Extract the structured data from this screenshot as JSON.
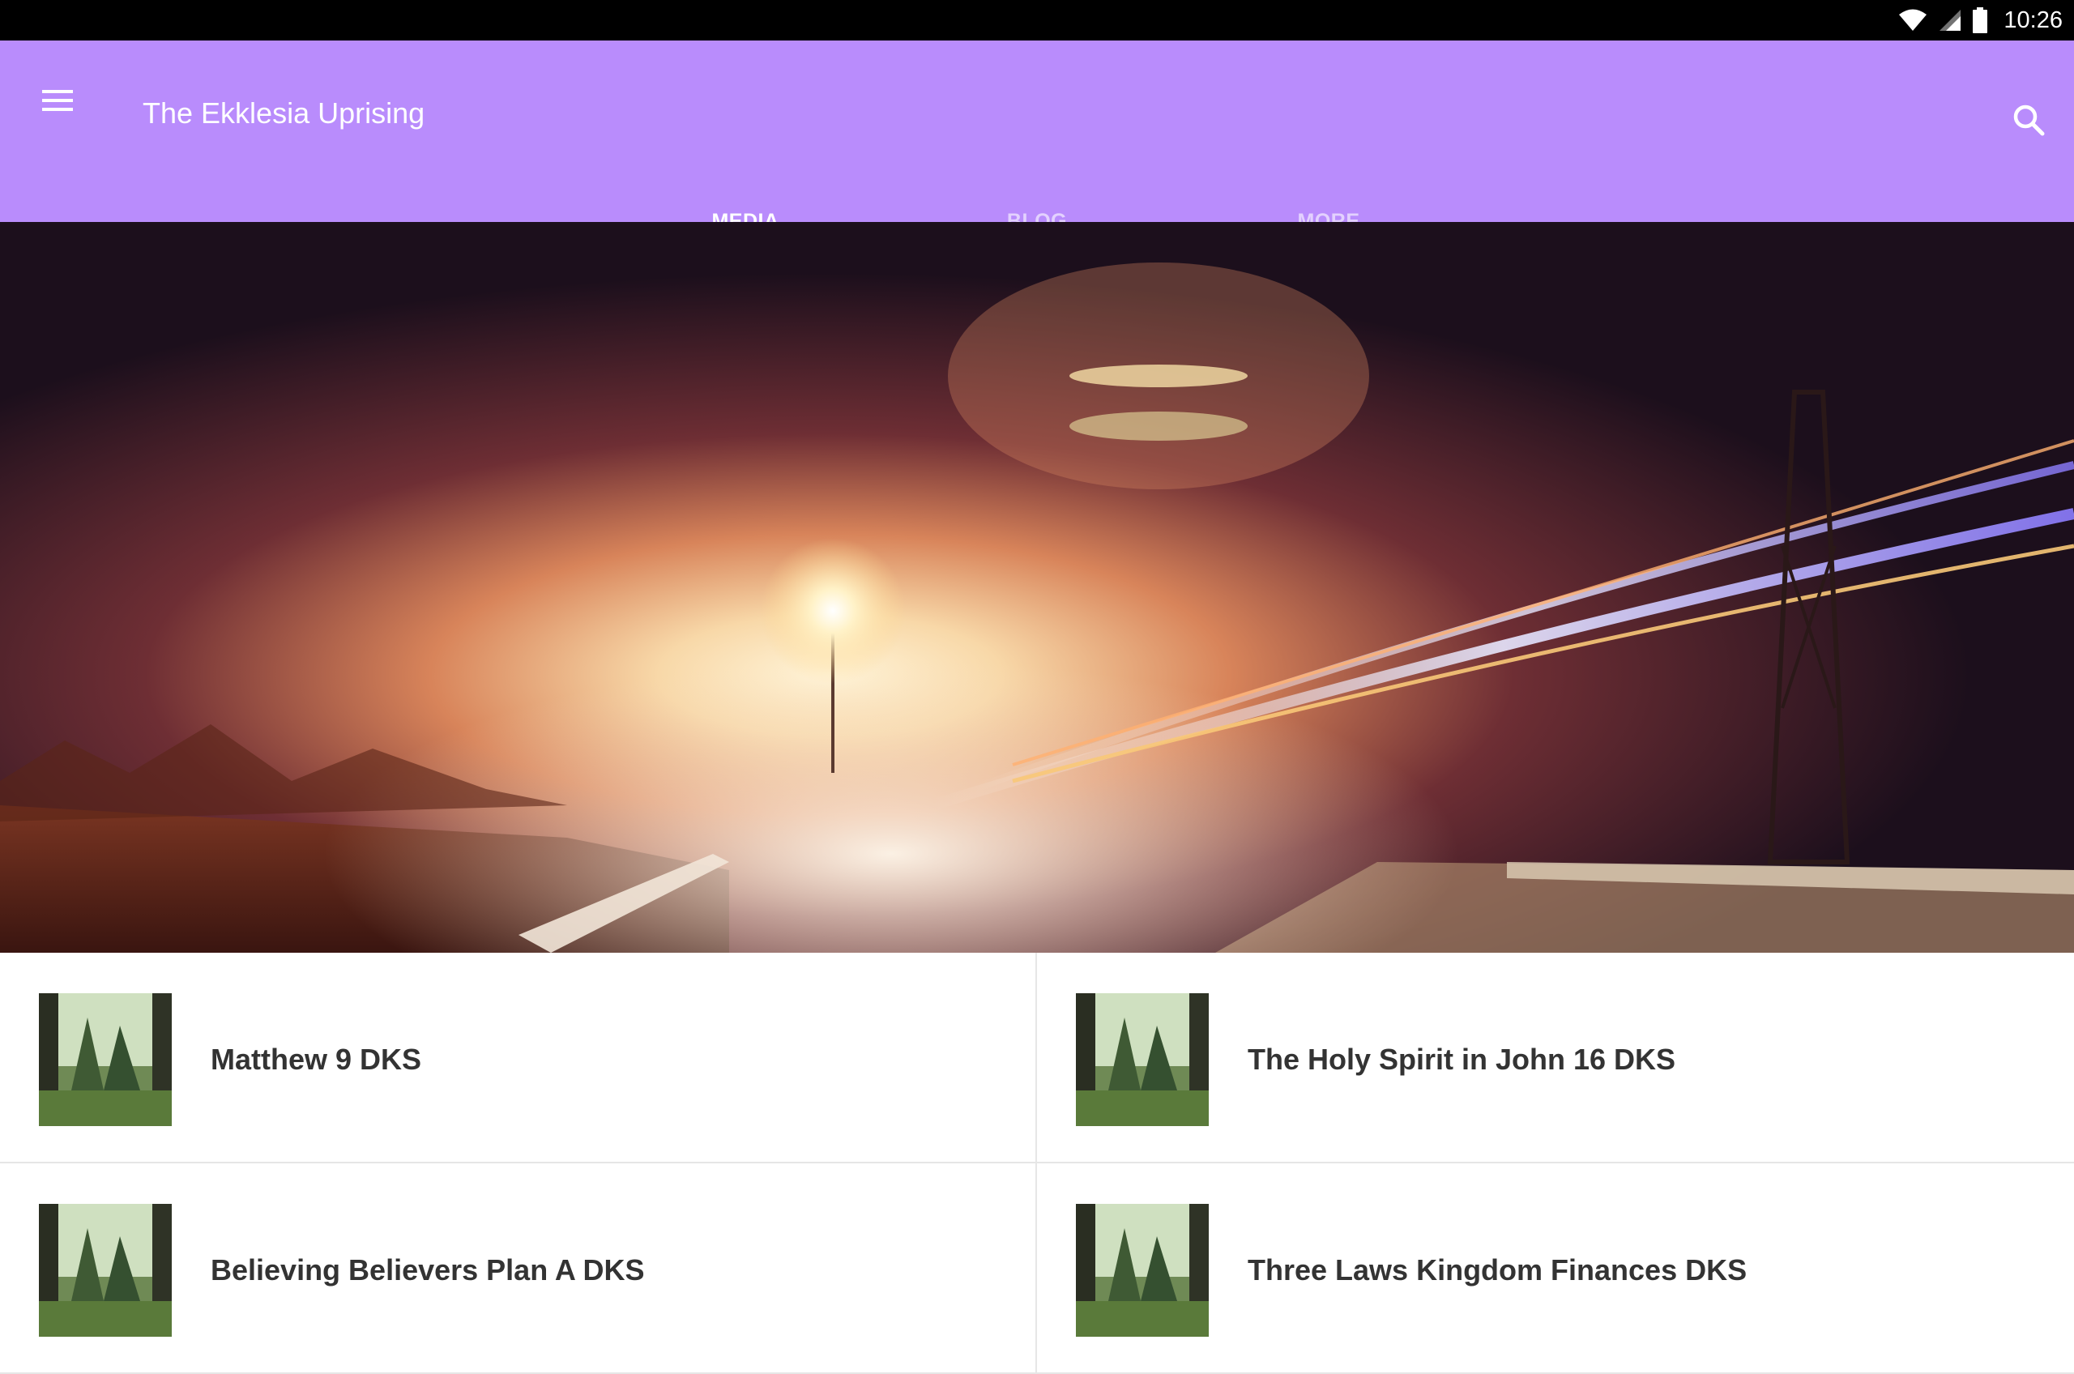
{
  "status_bar": {
    "time": "10:26",
    "icons": [
      "wifi-icon",
      "cellular-signal-icon",
      "battery-icon"
    ]
  },
  "app_bar": {
    "title": "The Ekklesia Uprising",
    "menu_icon": "hamburger-menu-icon",
    "search_icon": "search-icon",
    "background_color": "#b98cfc"
  },
  "tabs": [
    {
      "label": "MEDIA",
      "active": true
    },
    {
      "label": "BLOG",
      "active": false
    },
    {
      "label": "MORE",
      "active": false
    }
  ],
  "media_items": [
    {
      "title": "Matthew 9 DKS"
    },
    {
      "title": "The Holy Spirit in John 16 DKS"
    },
    {
      "title": "Believing Believers Plan A DKS"
    },
    {
      "title": "Three Laws Kingdom Finances DKS"
    }
  ]
}
